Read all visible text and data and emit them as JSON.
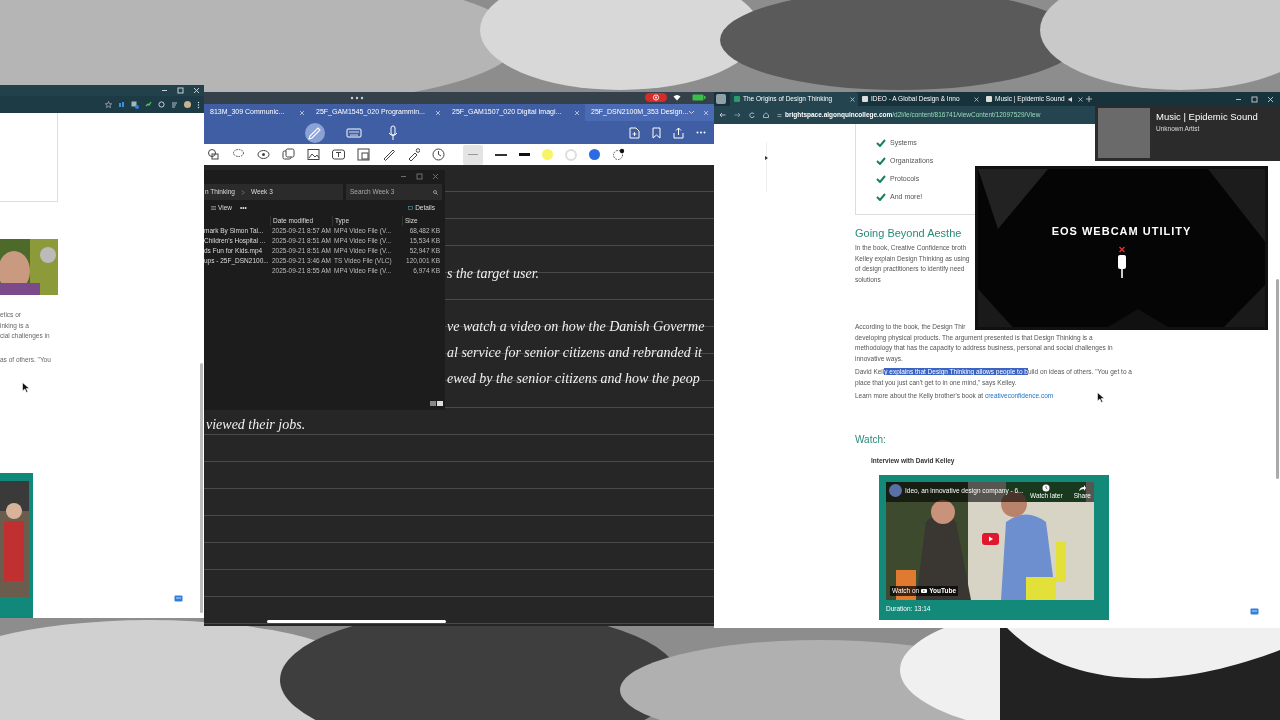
{
  "left_browser": {
    "text_lines": [
      "etics or",
      "inking is a",
      "cial challenges in",
      "as of others. \"You"
    ]
  },
  "notes_app": {
    "tabs": [
      {
        "label": "813M_309 Communic...",
        "selected": false
      },
      {
        "label": "25F_GAM1545_020 Programmin...",
        "selected": false
      },
      {
        "label": "25F_GAM1507_020 Digital Imagi...",
        "selected": false
      },
      {
        "label": "25F_DSN2100M_353 Design...",
        "selected": true
      }
    ],
    "input_modes": [
      {
        "kind": "pen",
        "selected": true
      },
      {
        "kind": "keyboard",
        "selected": false
      },
      {
        "kind": "mic",
        "selected": false
      }
    ],
    "handwriting": [
      "s the target user.",
      "ve watch a video on how the Danish Goverme",
      "al service for senior citizens and rebranded it",
      "ewed by the senior citizens and how the peop",
      "viewed their jobs."
    ]
  },
  "file_explorer": {
    "breadcrumb": [
      "n Thinking",
      "Week 3"
    ],
    "search_placeholder": "Search Week 3",
    "view_label": "View",
    "more": "•••",
    "details_label": "Details",
    "columns": [
      "Date modified",
      "Type",
      "Size"
    ],
    "rows": [
      {
        "name": "mark By Simon Tal...",
        "date": "2025-09-21 8:57 AM",
        "type": "MP4 Video File (V...",
        "size": "68,482 KB"
      },
      {
        "name": "Children's Hospital ...",
        "date": "2025-09-21 8:51 AM",
        "type": "MP4 Video File (V...",
        "size": "15,534 KB"
      },
      {
        "name": "ds Fun for Kids.mp4",
        "date": "2025-09-21 8:51 AM",
        "type": "MP4 Video File (V...",
        "size": "52,947 KB"
      },
      {
        "name": "ups - 25F_DSN2100...",
        "date": "2025-09-21 3:46 AM",
        "type": "TS Video File (VLC)",
        "size": "120,001 KB"
      },
      {
        "date": "2025-09-21 8:55 AM",
        "type": "MP4 Video File (V...",
        "size": "6,974 KB"
      }
    ]
  },
  "browser": {
    "tabs": [
      {
        "label": "The Origins of Design Thinking",
        "selected": true
      },
      {
        "label": "IDEO - A Global Design & Inno",
        "selected": false
      },
      {
        "label": "Music | Epidemic Sound",
        "selected": false
      }
    ],
    "url_host": "brightspace.algonquincollege.com",
    "url_path": "/d2l/le/content/816741/viewContent/12097529/View",
    "checklist": [
      "Systems",
      "Organizations",
      "Protocols",
      "And more!"
    ],
    "heading": "Going Beyond Aesthe",
    "paragraph_1": [
      "In the book, Creative Confidence broth",
      "Kelley explain Design Thinking as using",
      "of design practitioners to identify need",
      "solutions"
    ],
    "paragraph_2": [
      "According to the book, the Design Thir",
      "developing physical products. The argument presented is that Design Thinking is a",
      "methodology that has the capacity to address business, personal and social challenges in",
      "innovative ways."
    ],
    "paragraph_3": [
      {
        "text": "David Kell",
        "highlighted": false
      },
      {
        "text": "y explains that Design Thinking allows people to b",
        "highlighted": true
      },
      {
        "text": "uild on ideas of others. \"You get to a place that you just can't get to in one mind,\" says Kelley.",
        "highlighted": false
      }
    ],
    "paragraph_4": {
      "text": "Learn more about the Kelly brother's book at ",
      "link": "creativeconfidence.com"
    },
    "watch_heading": "Watch:",
    "video_caption": "Interview with David Kelley",
    "video": {
      "title": "Ideo, an innovative design company - 6...",
      "watch_later": "Watch later",
      "share": "Share",
      "watch_on": "Watch on",
      "youtube": "YouTube",
      "duration": "Duration: 13:14"
    }
  },
  "media_overlay": {
    "title": "Music | Epidemic Sound",
    "artist": "Unknown Artist"
  },
  "webcam": {
    "title": "EOS WEBCAM UTILITY"
  }
}
